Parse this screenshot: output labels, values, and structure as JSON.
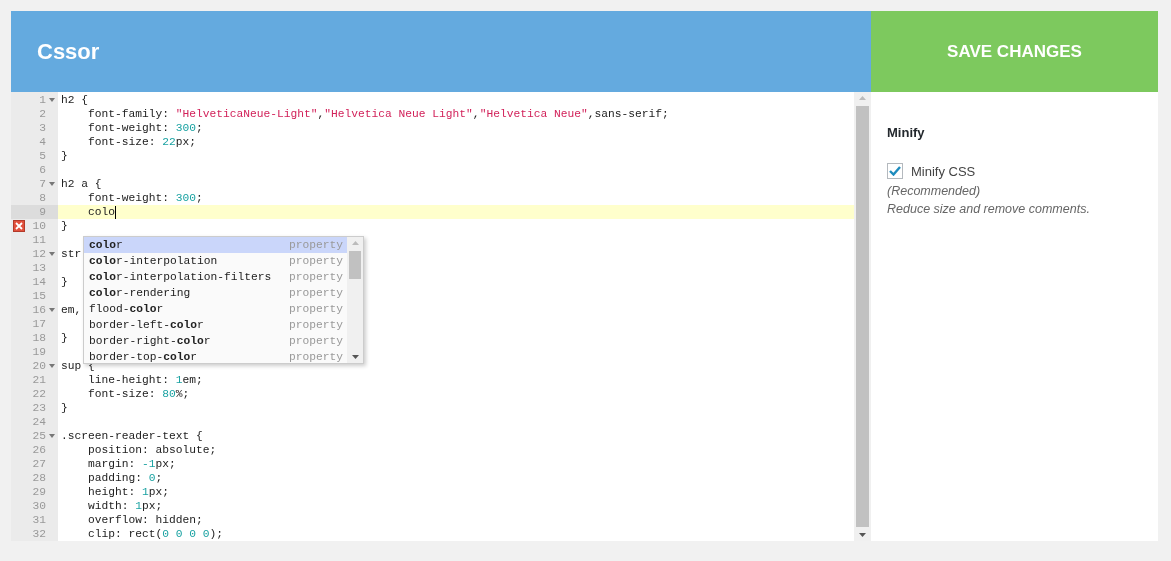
{
  "header": {
    "title": "Cssor"
  },
  "save_button": {
    "label": "SAVE CHANGES"
  },
  "editor": {
    "lines": [
      {
        "number": "1",
        "foldable": true,
        "active": false,
        "error": false,
        "tokens": [
          {
            "kind": "plain",
            "text": "h2 {"
          }
        ]
      },
      {
        "number": "2",
        "foldable": false,
        "active": false,
        "error": false,
        "tokens": [
          {
            "kind": "plain",
            "text": "    font-family: "
          },
          {
            "kind": "string",
            "text": "\"HelveticaNeue-Light\""
          },
          {
            "kind": "plain",
            "text": ","
          },
          {
            "kind": "string",
            "text": "\"Helvetica Neue Light\""
          },
          {
            "kind": "plain",
            "text": ","
          },
          {
            "kind": "string",
            "text": "\"Helvetica Neue\""
          },
          {
            "kind": "plain",
            "text": ",sans-serif;"
          }
        ]
      },
      {
        "number": "3",
        "foldable": false,
        "active": false,
        "error": false,
        "tokens": [
          {
            "kind": "plain",
            "text": "    font-weight: "
          },
          {
            "kind": "number",
            "text": "300"
          },
          {
            "kind": "plain",
            "text": ";"
          }
        ]
      },
      {
        "number": "4",
        "foldable": false,
        "active": false,
        "error": false,
        "tokens": [
          {
            "kind": "plain",
            "text": "    font-size: "
          },
          {
            "kind": "number",
            "text": "22"
          },
          {
            "kind": "plain",
            "text": "px;"
          }
        ]
      },
      {
        "number": "5",
        "foldable": false,
        "active": false,
        "error": false,
        "tokens": [
          {
            "kind": "plain",
            "text": "}"
          }
        ]
      },
      {
        "number": "6",
        "foldable": false,
        "active": false,
        "error": false
      },
      {
        "number": "7",
        "foldable": true,
        "active": false,
        "error": false,
        "tokens": [
          {
            "kind": "plain",
            "text": "h2 a {"
          }
        ]
      },
      {
        "number": "8",
        "foldable": false,
        "active": false,
        "error": false,
        "tokens": [
          {
            "kind": "plain",
            "text": "    font-weight: "
          },
          {
            "kind": "number",
            "text": "300"
          },
          {
            "kind": "plain",
            "text": ";"
          }
        ]
      },
      {
        "number": "9",
        "foldable": false,
        "active": true,
        "error": false,
        "tokens": [
          {
            "kind": "plain",
            "text": "    colo"
          }
        ]
      },
      {
        "number": "10",
        "foldable": false,
        "active": false,
        "error": true,
        "tokens": [
          {
            "kind": "plain",
            "text": "}"
          }
        ]
      },
      {
        "number": "11",
        "foldable": false,
        "active": false,
        "error": false
      },
      {
        "number": "12",
        "foldable": true,
        "active": false,
        "error": false,
        "tokens": [
          {
            "kind": "plain",
            "text": "str"
          }
        ]
      },
      {
        "number": "13",
        "foldable": false,
        "active": false,
        "error": false
      },
      {
        "number": "14",
        "foldable": false,
        "active": false,
        "error": false,
        "tokens": [
          {
            "kind": "plain",
            "text": "}"
          }
        ]
      },
      {
        "number": "15",
        "foldable": false,
        "active": false,
        "error": false
      },
      {
        "number": "16",
        "foldable": true,
        "active": false,
        "error": false,
        "tokens": [
          {
            "kind": "plain",
            "text": "em,"
          }
        ]
      },
      {
        "number": "17",
        "foldable": false,
        "active": false,
        "error": false
      },
      {
        "number": "18",
        "foldable": false,
        "active": false,
        "error": false,
        "tokens": [
          {
            "kind": "plain",
            "text": "}"
          }
        ]
      },
      {
        "number": "19",
        "foldable": false,
        "active": false,
        "error": false
      },
      {
        "number": "20",
        "foldable": true,
        "active": false,
        "error": false,
        "tokens": [
          {
            "kind": "plain",
            "text": "sup {"
          }
        ]
      },
      {
        "number": "21",
        "foldable": false,
        "active": false,
        "error": false,
        "tokens": [
          {
            "kind": "plain",
            "text": "    line-height: "
          },
          {
            "kind": "number",
            "text": "1"
          },
          {
            "kind": "plain",
            "text": "em;"
          }
        ]
      },
      {
        "number": "22",
        "foldable": false,
        "active": false,
        "error": false,
        "tokens": [
          {
            "kind": "plain",
            "text": "    font-size: "
          },
          {
            "kind": "number",
            "text": "80"
          },
          {
            "kind": "plain",
            "text": "%;"
          }
        ]
      },
      {
        "number": "23",
        "foldable": false,
        "active": false,
        "error": false,
        "tokens": [
          {
            "kind": "plain",
            "text": "}"
          }
        ]
      },
      {
        "number": "24",
        "foldable": false,
        "active": false,
        "error": false
      },
      {
        "number": "25",
        "foldable": true,
        "active": false,
        "error": false,
        "tokens": [
          {
            "kind": "plain",
            "text": ".screen-reader-text {"
          }
        ]
      },
      {
        "number": "26",
        "foldable": false,
        "active": false,
        "error": false,
        "tokens": [
          {
            "kind": "plain",
            "text": "    position: absolute;"
          }
        ]
      },
      {
        "number": "27",
        "foldable": false,
        "active": false,
        "error": false,
        "tokens": [
          {
            "kind": "plain",
            "text": "    margin: "
          },
          {
            "kind": "number",
            "text": "-1"
          },
          {
            "kind": "plain",
            "text": "px;"
          }
        ]
      },
      {
        "number": "28",
        "foldable": false,
        "active": false,
        "error": false,
        "tokens": [
          {
            "kind": "plain",
            "text": "    padding: "
          },
          {
            "kind": "number",
            "text": "0"
          },
          {
            "kind": "plain",
            "text": ";"
          }
        ]
      },
      {
        "number": "29",
        "foldable": false,
        "active": false,
        "error": false,
        "tokens": [
          {
            "kind": "plain",
            "text": "    height: "
          },
          {
            "kind": "number",
            "text": "1"
          },
          {
            "kind": "plain",
            "text": "px;"
          }
        ]
      },
      {
        "number": "30",
        "foldable": false,
        "active": false,
        "error": false,
        "tokens": [
          {
            "kind": "plain",
            "text": "    width: "
          },
          {
            "kind": "number",
            "text": "1"
          },
          {
            "kind": "plain",
            "text": "px;"
          }
        ]
      },
      {
        "number": "31",
        "foldable": false,
        "active": false,
        "error": false,
        "tokens": [
          {
            "kind": "plain",
            "text": "    overflow: hidden;"
          }
        ]
      },
      {
        "number": "32",
        "foldable": false,
        "active": false,
        "error": false,
        "tokens": [
          {
            "kind": "plain",
            "text": "    clip: rect("
          },
          {
            "kind": "number",
            "text": "0 0 0 0"
          },
          {
            "kind": "plain",
            "text": ");"
          }
        ]
      }
    ]
  },
  "autocomplete": {
    "items": [
      {
        "label": "**colo**r",
        "type": "property",
        "selected": true
      },
      {
        "label": "**colo**r-interpolation",
        "type": "property",
        "selected": false
      },
      {
        "label": "**colo**r-interpolation-filters",
        "type": "property",
        "selected": false
      },
      {
        "label": "**colo**r-rendering",
        "type": "property",
        "selected": false
      },
      {
        "label": "flood-**colo**r",
        "type": "property",
        "selected": false
      },
      {
        "label": "border-left-**colo**r",
        "type": "property",
        "selected": false
      },
      {
        "label": "border-right-**colo**r",
        "type": "property",
        "selected": false
      },
      {
        "label": "border-top-**colo**r",
        "type": "property",
        "selected": false
      }
    ]
  },
  "settings": {
    "heading": "Minify",
    "checkbox": {
      "label": "Minify CSS",
      "checked": true
    },
    "note": "(Recommended)",
    "description": "Reduce size and remove comments."
  }
}
